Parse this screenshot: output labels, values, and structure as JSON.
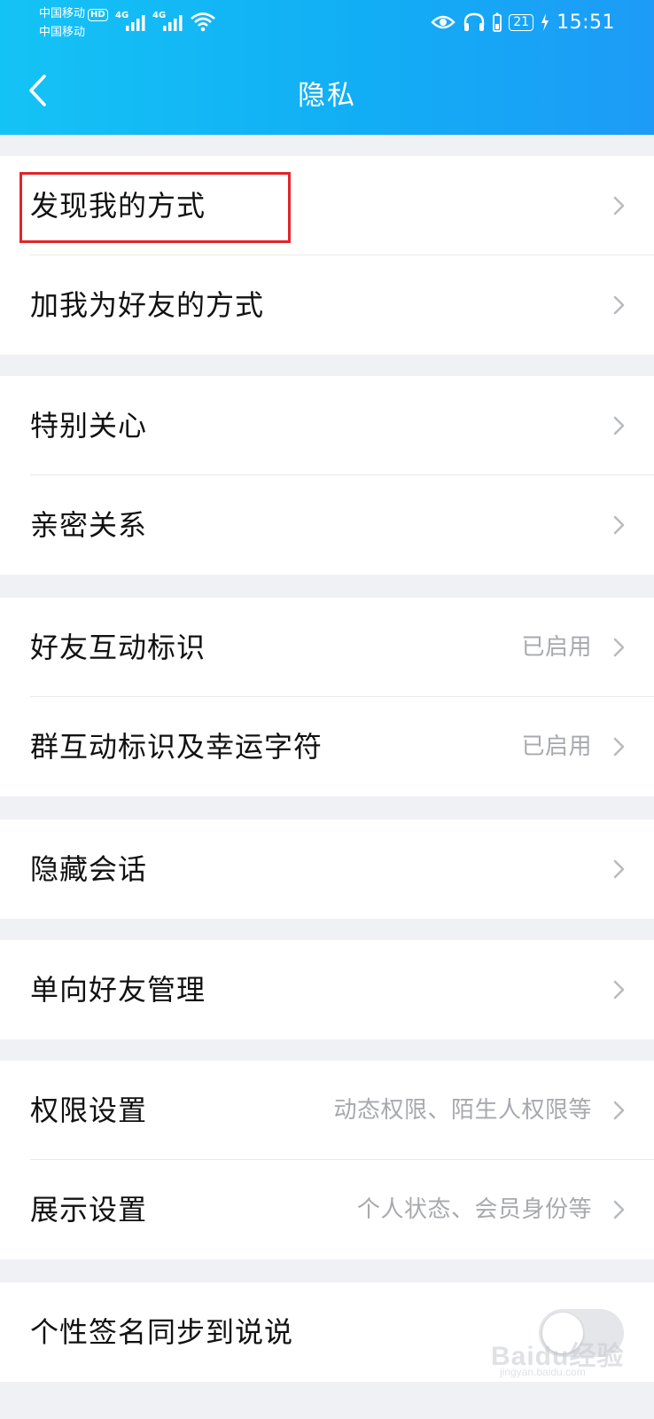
{
  "status_bar": {
    "carrier_1": "中国移动",
    "carrier_1_badge": "HD",
    "carrier_2": "中国移动",
    "net_1": "4G",
    "net_2": "4G",
    "battery": "21",
    "time": "15:51"
  },
  "header": {
    "title": "隐私",
    "back_icon": "chevron-left-icon"
  },
  "groups": [
    {
      "rows": [
        {
          "label": "发现我的方式",
          "value": "",
          "highlighted": true
        },
        {
          "label": "加我为好友的方式",
          "value": ""
        }
      ]
    },
    {
      "rows": [
        {
          "label": "特别关心",
          "value": ""
        },
        {
          "label": "亲密关系",
          "value": ""
        }
      ]
    },
    {
      "rows": [
        {
          "label": "好友互动标识",
          "value": "已启用"
        },
        {
          "label": "群互动标识及幸运字符",
          "value": "已启用"
        }
      ]
    },
    {
      "rows": [
        {
          "label": "隐藏会话",
          "value": ""
        }
      ]
    },
    {
      "rows": [
        {
          "label": "单向好友管理",
          "value": ""
        }
      ]
    },
    {
      "rows": [
        {
          "label": "权限设置",
          "value": "动态权限、陌生人权限等"
        },
        {
          "label": "展示设置",
          "value": "个人状态、会员身份等"
        }
      ]
    },
    {
      "rows": [
        {
          "label": "个性签名同步到说说",
          "toggle": false
        }
      ]
    }
  ],
  "watermark": {
    "text": "Baidu经验",
    "sub": "jingyan.baidu.com"
  },
  "colors": {
    "header_start": "#14c3f5",
    "header_end": "#1d9bf6",
    "highlight": "#e0252a",
    "background": "#f0f1f5"
  }
}
